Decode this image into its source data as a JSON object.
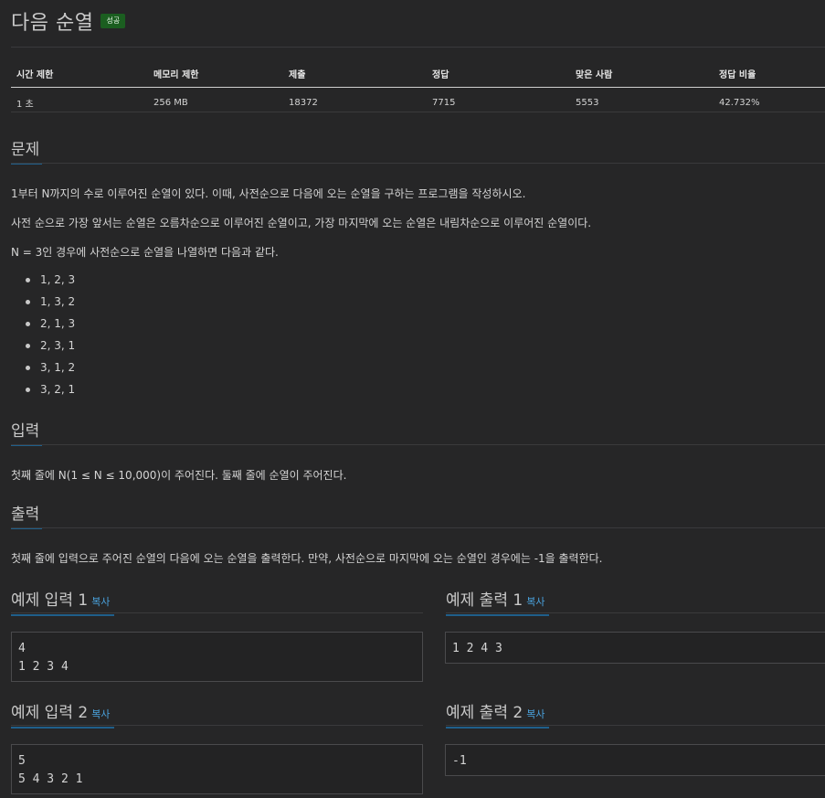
{
  "problem": {
    "title": "다음 순열",
    "badge": "성공"
  },
  "info_table": {
    "headers": [
      "시간 제한",
      "메모리 제한",
      "제출",
      "정답",
      "맞은 사람",
      "정답 비율"
    ],
    "values": [
      "1 초",
      "256 MB",
      "18372",
      "7715",
      "5553",
      "42.732%"
    ]
  },
  "sections": {
    "problem_heading": "문제",
    "problem_paragraphs": [
      "1부터 N까지의 수로 이루어진 순열이 있다. 이때, 사전순으로 다음에 오는 순열을 구하는 프로그램을 작성하시오.",
      "사전 순으로 가장 앞서는 순열은 오름차순으로 이루어진 순열이고, 가장 마지막에 오는 순열은 내림차순으로 이루어진 순열이다.",
      "N = 3인 경우에 사전순으로 순열을 나열하면 다음과 같다."
    ],
    "permutations": [
      "1, 2, 3",
      "1, 3, 2",
      "2, 1, 3",
      "2, 3, 1",
      "3, 1, 2",
      "3, 2, 1"
    ],
    "input_heading": "입력",
    "input_text": "첫째 줄에 N(1 ≤ N ≤ 10,000)이 주어진다. 둘째 줄에 순열이 주어진다.",
    "output_heading": "출력",
    "output_text": "첫째 줄에 입력으로 주어진 순열의 다음에 오는 순열을 출력한다. 만약, 사전순으로 마지막에 오는 순열인 경우에는 -1을 출력한다."
  },
  "samples": {
    "copy_label": "복사",
    "input1_title": "예제 입력 1",
    "input1_body": "4\n1 2 3 4",
    "output1_title": "예제 출력 1",
    "output1_body": "1 2 4 3",
    "input2_title": "예제 입력 2",
    "input2_body": "5\n5 4 3 2 1",
    "output2_title": "예제 출력 2",
    "output2_body": "-1"
  },
  "colors": {
    "background": "#262627",
    "badge_success": "#1b5e20",
    "copy_link": "#4aa3df",
    "heading_underline": "#1f5f8b"
  }
}
